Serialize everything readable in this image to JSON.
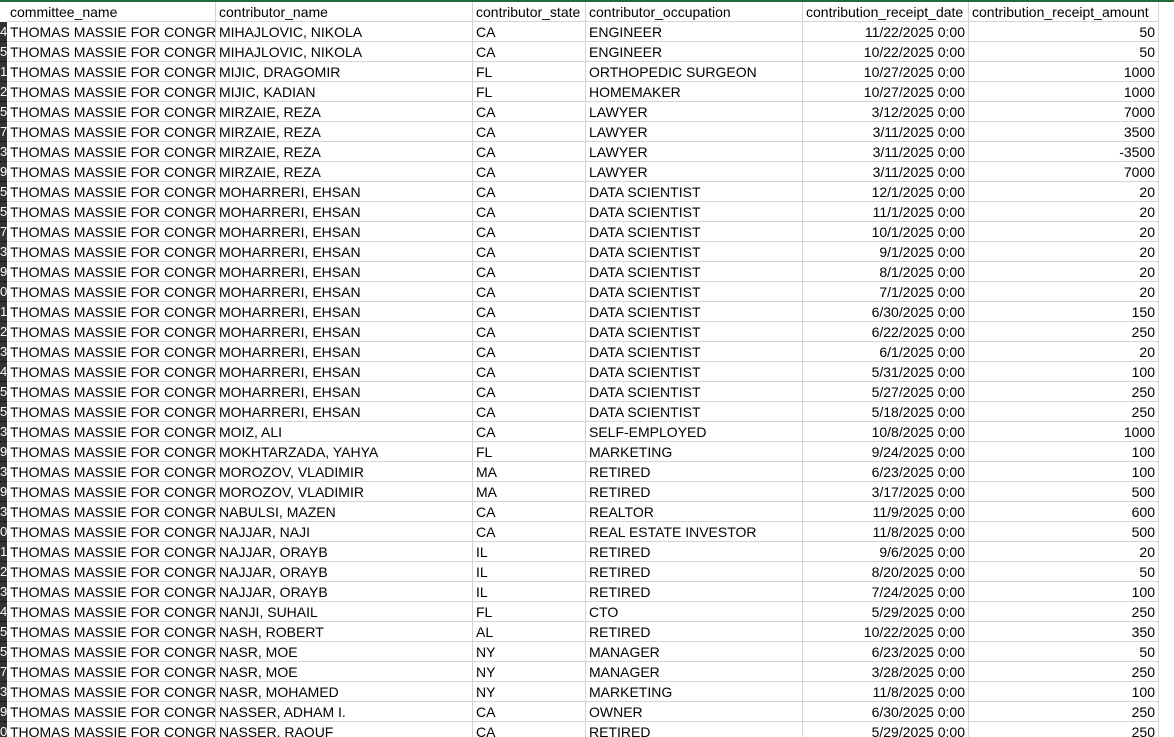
{
  "columns": [
    "committee_name",
    "contributor_name",
    "contributor_state",
    "contributor_occupation",
    "contribution_receipt_date",
    "contribution_receipt_amount"
  ],
  "row_numbers": [
    "4",
    "5",
    "1",
    "2",
    "5",
    "7",
    "3",
    "9",
    "5",
    "5",
    "7",
    "3",
    "9",
    "0",
    "1",
    "2",
    "3",
    "4",
    "5",
    "5",
    "3",
    "9",
    "3",
    "9",
    "3",
    "0",
    "1",
    "2",
    "3",
    "4",
    "5",
    "5",
    "7",
    "3",
    "9",
    "0"
  ],
  "rows": [
    [
      "THOMAS MASSIE FOR CONGRESS",
      "MIHAJLOVIC, NIKOLA",
      "CA",
      "ENGINEER",
      "11/22/2025 0:00",
      "50"
    ],
    [
      "THOMAS MASSIE FOR CONGRESS",
      "MIHAJLOVIC, NIKOLA",
      "CA",
      "ENGINEER",
      "10/22/2025 0:00",
      "50"
    ],
    [
      "THOMAS MASSIE FOR CONGRESS",
      "MIJIC, DRAGOMIR",
      "FL",
      "ORTHOPEDIC SURGEON",
      "10/27/2025 0:00",
      "1000"
    ],
    [
      "THOMAS MASSIE FOR CONGRESS",
      "MIJIC, KADIAN",
      "FL",
      "HOMEMAKER",
      "10/27/2025 0:00",
      "1000"
    ],
    [
      "THOMAS MASSIE FOR CONGRESS",
      "MIRZAIE, REZA",
      "CA",
      "LAWYER",
      "3/12/2025 0:00",
      "7000"
    ],
    [
      "THOMAS MASSIE FOR CONGRESS",
      "MIRZAIE, REZA",
      "CA",
      "LAWYER",
      "3/11/2025 0:00",
      "3500"
    ],
    [
      "THOMAS MASSIE FOR CONGRESS",
      "MIRZAIE, REZA",
      "CA",
      "LAWYER",
      "3/11/2025 0:00",
      "-3500"
    ],
    [
      "THOMAS MASSIE FOR CONGRESS",
      "MIRZAIE, REZA",
      "CA",
      "LAWYER",
      "3/11/2025 0:00",
      "7000"
    ],
    [
      "THOMAS MASSIE FOR CONGRESS",
      "MOHARRERI, EHSAN",
      "CA",
      "DATA SCIENTIST",
      "12/1/2025 0:00",
      "20"
    ],
    [
      "THOMAS MASSIE FOR CONGRESS",
      "MOHARRERI, EHSAN",
      "CA",
      "DATA SCIENTIST",
      "11/1/2025 0:00",
      "20"
    ],
    [
      "THOMAS MASSIE FOR CONGRESS",
      "MOHARRERI, EHSAN",
      "CA",
      "DATA SCIENTIST",
      "10/1/2025 0:00",
      "20"
    ],
    [
      "THOMAS MASSIE FOR CONGRESS",
      "MOHARRERI, EHSAN",
      "CA",
      "DATA SCIENTIST",
      "9/1/2025 0:00",
      "20"
    ],
    [
      "THOMAS MASSIE FOR CONGRESS",
      "MOHARRERI, EHSAN",
      "CA",
      "DATA SCIENTIST",
      "8/1/2025 0:00",
      "20"
    ],
    [
      "THOMAS MASSIE FOR CONGRESS",
      "MOHARRERI, EHSAN",
      "CA",
      "DATA SCIENTIST",
      "7/1/2025 0:00",
      "20"
    ],
    [
      "THOMAS MASSIE FOR CONGRESS",
      "MOHARRERI, EHSAN",
      "CA",
      "DATA SCIENTIST",
      "6/30/2025 0:00",
      "150"
    ],
    [
      "THOMAS MASSIE FOR CONGRESS",
      "MOHARRERI, EHSAN",
      "CA",
      "DATA SCIENTIST",
      "6/22/2025 0:00",
      "250"
    ],
    [
      "THOMAS MASSIE FOR CONGRESS",
      "MOHARRERI, EHSAN",
      "CA",
      "DATA SCIENTIST",
      "6/1/2025 0:00",
      "20"
    ],
    [
      "THOMAS MASSIE FOR CONGRESS",
      "MOHARRERI, EHSAN",
      "CA",
      "DATA SCIENTIST",
      "5/31/2025 0:00",
      "100"
    ],
    [
      "THOMAS MASSIE FOR CONGRESS",
      "MOHARRERI, EHSAN",
      "CA",
      "DATA SCIENTIST",
      "5/27/2025 0:00",
      "250"
    ],
    [
      "THOMAS MASSIE FOR CONGRESS",
      "MOHARRERI, EHSAN",
      "CA",
      "DATA SCIENTIST",
      "5/18/2025 0:00",
      "250"
    ],
    [
      "THOMAS MASSIE FOR CONGRESS",
      "MOIZ, ALI",
      "CA",
      "SELF-EMPLOYED",
      "10/8/2025 0:00",
      "1000"
    ],
    [
      "THOMAS MASSIE FOR CONGRESS",
      "MOKHTARZADA, YAHYA",
      "FL",
      "MARKETING",
      "9/24/2025 0:00",
      "100"
    ],
    [
      "THOMAS MASSIE FOR CONGRESS",
      "MOROZOV, VLADIMIR",
      "MA",
      "RETIRED",
      "6/23/2025 0:00",
      "100"
    ],
    [
      "THOMAS MASSIE FOR CONGRESS",
      "MOROZOV, VLADIMIR",
      "MA",
      "RETIRED",
      "3/17/2025 0:00",
      "500"
    ],
    [
      "THOMAS MASSIE FOR CONGRESS",
      "NABULSI, MAZEN",
      "CA",
      "REALTOR",
      "11/9/2025 0:00",
      "600"
    ],
    [
      "THOMAS MASSIE FOR CONGRESS",
      "NAJJAR, NAJI",
      "CA",
      "REAL ESTATE INVESTOR",
      "11/8/2025 0:00",
      "500"
    ],
    [
      "THOMAS MASSIE FOR CONGRESS",
      "NAJJAR, ORAYB",
      "IL",
      "RETIRED",
      "9/6/2025 0:00",
      "20"
    ],
    [
      "THOMAS MASSIE FOR CONGRESS",
      "NAJJAR, ORAYB",
      "IL",
      "RETIRED",
      "8/20/2025 0:00",
      "50"
    ],
    [
      "THOMAS MASSIE FOR CONGRESS",
      "NAJJAR, ORAYB",
      "IL",
      "RETIRED",
      "7/24/2025 0:00",
      "100"
    ],
    [
      "THOMAS MASSIE FOR CONGRESS",
      "NANJI, SUHAIL",
      "FL",
      "CTO",
      "5/29/2025 0:00",
      "250"
    ],
    [
      "THOMAS MASSIE FOR CONGRESS",
      "NASH, ROBERT",
      "AL",
      "RETIRED",
      "10/22/2025 0:00",
      "350"
    ],
    [
      "THOMAS MASSIE FOR CONGRESS",
      "NASR, MOE",
      "NY",
      "MANAGER",
      "6/23/2025 0:00",
      "50"
    ],
    [
      "THOMAS MASSIE FOR CONGRESS",
      "NASR, MOE",
      "NY",
      "MANAGER",
      "3/28/2025 0:00",
      "250"
    ],
    [
      "THOMAS MASSIE FOR CONGRESS",
      "NASR, MOHAMED",
      "NY",
      "MARKETING",
      "11/8/2025 0:00",
      "100"
    ],
    [
      "THOMAS MASSIE FOR CONGRESS",
      "NASSER, ADHAM I.",
      "CA",
      "OWNER",
      "6/30/2025 0:00",
      "250"
    ],
    [
      "THOMAS MASSIE FOR CONGRESS",
      "NASSER, RAOUF",
      "CA",
      "RETIRED",
      "5/29/2025 0:00",
      "250"
    ]
  ]
}
